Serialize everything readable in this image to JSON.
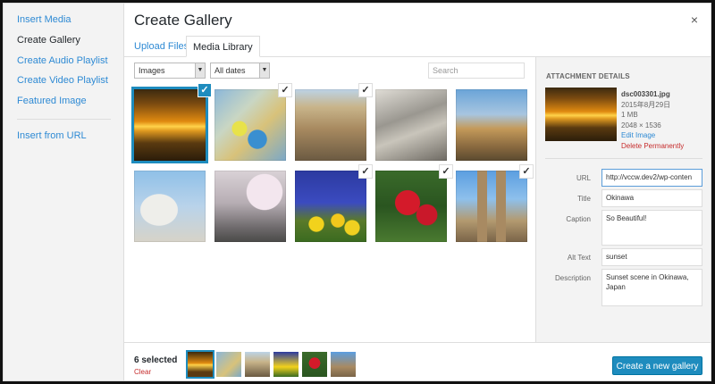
{
  "menu": {
    "items": [
      {
        "label": "Insert Media"
      },
      {
        "label": "Create Gallery"
      },
      {
        "label": "Create Audio Playlist"
      },
      {
        "label": "Create Video Playlist"
      },
      {
        "label": "Featured Image"
      },
      {
        "label": "Insert from URL"
      }
    ],
    "active_index": 1
  },
  "title": "Create Gallery",
  "close_glyph": "×",
  "tabs": [
    {
      "label": "Upload Files"
    },
    {
      "label": "Media Library"
    }
  ],
  "toolbar": {
    "filter_value": "Images",
    "date_value": "All dates",
    "search_placeholder": "Search"
  },
  "grid": {
    "items": [
      {
        "image": "sunset-sea",
        "checked": true,
        "main": true
      },
      {
        "image": "mosaic-lizard",
        "checked": true,
        "main": false
      },
      {
        "image": "ornate-building",
        "checked": true,
        "main": false
      },
      {
        "image": "stone-facade",
        "checked": false,
        "main": false
      },
      {
        "image": "plaza-horse-carriage",
        "checked": false,
        "main": false
      },
      {
        "image": "statue-dome",
        "checked": false,
        "main": false
      },
      {
        "image": "cherry-blossom-temple",
        "checked": false,
        "main": false
      },
      {
        "image": "yellow-tulips",
        "checked": true,
        "main": false
      },
      {
        "image": "red-roses",
        "checked": true,
        "main": false
      },
      {
        "image": "gothic-cathedral",
        "checked": true,
        "main": false
      }
    ],
    "check_glyph": "✓"
  },
  "details": {
    "heading": "ATTACHMENT DETAILS",
    "filename": "dsc003301.jpg",
    "date": "2015年8月29日",
    "size": "1 MB",
    "dimensions": "2048 × 1536",
    "edit_label": "Edit Image",
    "delete_label": "Delete Permanently",
    "fields": {
      "url_label": "URL",
      "url_value": "http://vccw.dev2/wp-conten",
      "title_label": "Title",
      "title_value": "Okinawa",
      "caption_label": "Caption",
      "caption_value": "So Beautiful!",
      "alt_label": "Alt Text",
      "alt_value": "sunset",
      "desc_label": "Description",
      "desc_value": "Sunset scene in Okinawa, Japan"
    }
  },
  "footer": {
    "selected_text": "6 selected",
    "clear_label": "Clear",
    "create_label": "Create a new gallery"
  },
  "colors": {
    "accent": "#1e8cbe",
    "link": "#2e8ad4",
    "danger": "#c62d2d"
  }
}
